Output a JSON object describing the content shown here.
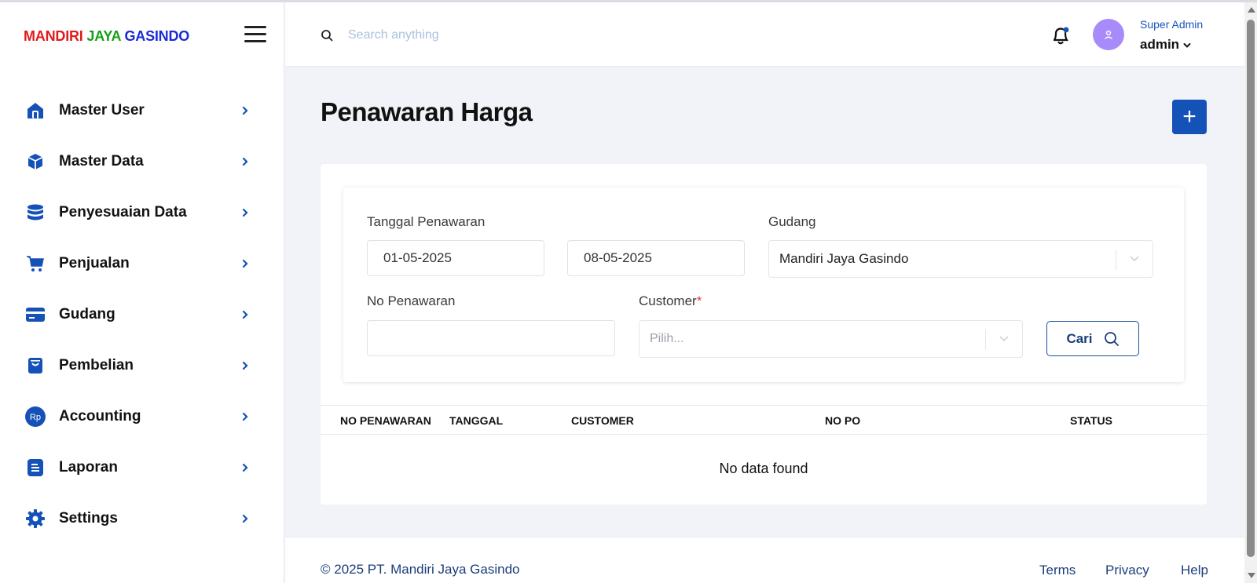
{
  "brand": {
    "word1": "MANDIRI",
    "word2": "JAYA",
    "word3": "GASINDO"
  },
  "sidebar": {
    "items": [
      {
        "label": "Master User",
        "icon": "home-icon"
      },
      {
        "label": "Master Data",
        "icon": "box-icon"
      },
      {
        "label": "Penyesuaian Data",
        "icon": "database-icon"
      },
      {
        "label": "Penjualan",
        "icon": "cart-icon"
      },
      {
        "label": "Gudang",
        "icon": "card-icon"
      },
      {
        "label": "Pembelian",
        "icon": "bag-icon"
      },
      {
        "label": "Accounting",
        "icon": "rp-icon",
        "icon_text": "Rp"
      },
      {
        "label": "Laporan",
        "icon": "document-icon"
      },
      {
        "label": "Settings",
        "icon": "gear-icon"
      }
    ]
  },
  "header": {
    "search_placeholder": "Search anything",
    "user_role": "Super Admin",
    "user_name": "admin"
  },
  "main": {
    "title": "Penawaran Harga",
    "add_label": "+",
    "filters": {
      "tanggal_label": "Tanggal Penawaran",
      "date_from": "01-05-2025",
      "date_to": "08-05-2025",
      "gudang_label": "Gudang",
      "gudang_value": "Mandiri Jaya Gasindo",
      "no_penawaran_label": "No Penawaran",
      "no_penawaran_value": "",
      "customer_label": "Customer",
      "customer_required": "*",
      "customer_placeholder": "Pilih...",
      "cari_label": "Cari"
    },
    "table": {
      "columns": [
        "NO PENAWARAN",
        "TANGGAL",
        "CUSTOMER",
        "NO PO",
        "STATUS"
      ],
      "empty_text": "No data found"
    }
  },
  "footer": {
    "copyright": "© 2025 PT. Mandiri Jaya Gasindo",
    "links": [
      "Terms",
      "Privacy",
      "Help"
    ]
  },
  "colors": {
    "primary": "#1552b8",
    "brand_red": "#e01b1b",
    "brand_green": "#16a016",
    "brand_blue": "#1a2bd6",
    "avatar": "#a78bfa",
    "link": "#1a3d7a"
  }
}
